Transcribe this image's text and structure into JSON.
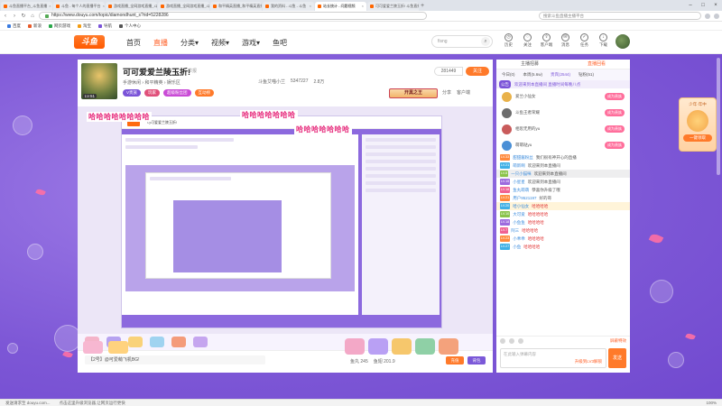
{
  "browser": {
    "tabs": [
      {
        "label": "斗鱼直播平台_斗鱼直播",
        "active": false
      },
      {
        "label": "斗鱼 - 每个人的直播平台",
        "active": false
      },
      {
        "label": "游戏直播_全网游戏直播_斗鱼直播",
        "active": false
      },
      {
        "label": "游戏直播_全网游戏直播_斗鱼直播",
        "active": false
      },
      {
        "label": "和平精英直播_和平精英直播视频",
        "active": false
      },
      {
        "label": "我的资料 - 斗鱼 - 斗鱼",
        "active": false
      },
      {
        "label": "站长统计 - 问题视频",
        "active": true
      },
      {
        "label": "可可爱爱兰陵玉折! 斗鱼直播",
        "active": false
      }
    ],
    "url": "https://www.douyu.com/topic/diamondhunt_s?rid=5228286",
    "search_placeholder": "搜索斗鱼直播主播平台",
    "bookmarks": [
      "百度",
      "新浪",
      "网页游戏",
      "淘宝",
      "导航",
      "个人中心"
    ]
  },
  "site": {
    "logo": "斗鱼",
    "nav": [
      {
        "label": "首页",
        "active": false
      },
      {
        "label": "直播",
        "active": true
      },
      {
        "label": "分类▾",
        "active": false
      },
      {
        "label": "视频▾",
        "active": false
      },
      {
        "label": "游戏▾",
        "active": false
      },
      {
        "label": "鱼吧",
        "active": false
      }
    ],
    "search_placeholder": "fisng",
    "header_icons": [
      {
        "icon": "history-icon",
        "label": "历史"
      },
      {
        "icon": "follow-icon",
        "label": "关注"
      },
      {
        "icon": "upload-icon",
        "label": "客户端"
      },
      {
        "icon": "message-icon",
        "label": "消息"
      },
      {
        "icon": "task-icon",
        "label": "任务"
      },
      {
        "icon": "download-icon",
        "label": "下载"
      }
    ]
  },
  "room": {
    "anchor_level": "LV.51",
    "title": "可可爱爱兰陵玉折!",
    "report": "举报",
    "category": "手游休闲 › 和平精英 › 娱乐区",
    "anchor_name": "斗鱼艾喵小兰",
    "popularity": "5347227",
    "extra": "2.8万",
    "follow_label": "关注",
    "fans_count": "281449",
    "tags": [
      {
        "label": "V贵族",
        "color": "#7a53d8"
      },
      {
        "label": "玩家",
        "color": "#e0507a"
      },
      {
        "label": "超级粉丝团",
        "color": "#c94bd6"
      },
      {
        "label": "互动榜",
        "color": "#ff7a2a"
      }
    ],
    "rank_badge": "开黑之王",
    "share": "分享",
    "client": "客户端",
    "danmu_overlay": [
      "哈哈哈哈哈哈哈",
      "哈哈哈哈哈哈哈哈",
      "哈哈哈哈哈哈哈"
    ],
    "mini_title": "可可爱爱兰陵玉折!",
    "dm_input": "【2号】@可爱萌飞机BG!",
    "coins": [
      "鱼丸 245",
      "鱼翅 201.9"
    ],
    "recharge": "充值",
    "buy": "背包"
  },
  "chat": {
    "top_tabs": [
      {
        "label": "主播招募",
        "active": false
      },
      {
        "label": "直播回看",
        "active": true
      }
    ],
    "rank_tabs": [
      {
        "label": "今日(0)",
        "active": false
      },
      {
        "label": "本周(5.6w)",
        "active": false
      },
      {
        "label": "贵宾(2544)",
        "active": true
      },
      {
        "label": "钻粉(51)",
        "active": false
      }
    ],
    "notice_tag": "公告",
    "notice": "欢迎来到本直播间 直播时间每晚八点",
    "vip_button": "成为贵族",
    "vips": [
      {
        "name": "爱兰小仙女",
        "btn": "成为贵族",
        "color": "#e9b24a"
      },
      {
        "name": "斗鱼王者荣耀",
        "btn": "成为贵族",
        "color": "#6c6c6c"
      },
      {
        "name": "相思无用的yu",
        "btn": "成为贵族",
        "color": "#c95b5b"
      },
      {
        "name": "萌萌哒yu",
        "btn": "成为贵族",
        "color": "#4a8fd6"
      }
    ],
    "messages": [
      {
        "level": "LV.33",
        "name": "甜甜酱粉丝",
        "text": "我们很有神开心的直播",
        "style": "normal"
      },
      {
        "level": "LV.21",
        "name": "萌新啊",
        "text": "欢迎来到本直播间",
        "style": "normal"
      },
      {
        "level": "LV.8",
        "name": "一只小猫咪",
        "text": "欢迎来到本直播间",
        "style": "sys"
      },
      {
        "level": "LV.15",
        "name": "小星星",
        "text": "欢迎来到本直播间",
        "style": "normal"
      },
      {
        "level": "LV.18",
        "name": "鱼丸萌萌",
        "text": "恭喜你升级了哦",
        "style": "normal"
      },
      {
        "level": "LV.21",
        "name": "用户9521197",
        "text": "好的哥",
        "style": "normal"
      },
      {
        "level": "LV.20",
        "name": "哈小仙女",
        "text": "哈哈哈哈",
        "style": "hl"
      },
      {
        "level": "LV.10",
        "name": "大可爱",
        "text": "哈哈哈哈哈",
        "style": "normal"
      },
      {
        "level": "LV.18",
        "name": "小鱼鱼",
        "text": "哈哈哈哈",
        "style": "normal"
      },
      {
        "level": "LV.7",
        "name": "阿三",
        "text": "哈哈哈哈",
        "style": "normal"
      },
      {
        "level": "LV.23",
        "name": "小乖乖",
        "text": "哈哈哈哈",
        "style": "normal"
      },
      {
        "level": "LV.27",
        "name": "小鱼",
        "text": "哈哈哈哈",
        "style": "normal"
      }
    ],
    "tools_label": "屏蔽特效",
    "input_placeholder": "在此输入弹幕内容",
    "input_hint": "升级到LV3解锁",
    "send": "发送"
  },
  "floater": {
    "title": "少年·年中",
    "cta": "一键领取"
  },
  "status": {
    "left": "发送请求至 douyu.com...",
    "mid": "点击这里升级浏览器,让网页运行更快",
    "right": [
      "100%"
    ]
  },
  "colors": {
    "accent": "#ff5d23",
    "brand_purple": "#7a53d8",
    "stage": "#8660da"
  }
}
